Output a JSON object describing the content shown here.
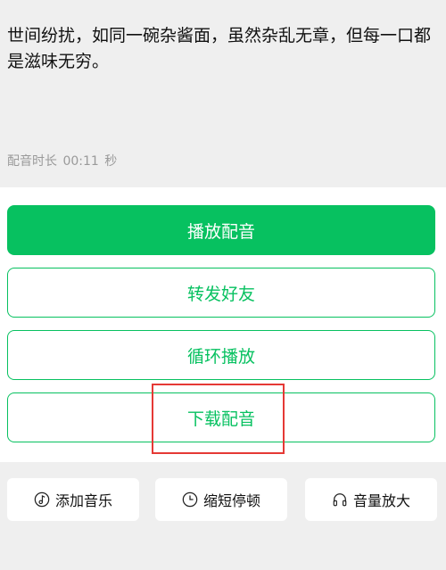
{
  "content": {
    "text": "世间纷扰，如同一碗杂酱面，虽然杂乱无章，但每一口都是滋味无穷。",
    "duration_label": "配音时长",
    "duration_value": "00:11",
    "duration_unit": "秒"
  },
  "actions": {
    "play": "播放配音",
    "share": "转发好友",
    "loop": "循环播放",
    "download": "下载配音"
  },
  "tools": [
    {
      "label": "添加音乐",
      "icon": "music-note-icon"
    },
    {
      "label": "缩短停顿",
      "icon": "clock-icon"
    },
    {
      "label": "音量放大",
      "icon": "headphones-icon"
    }
  ],
  "colors": {
    "accent": "#07c160",
    "highlight": "#e53935",
    "background": "#efefef"
  }
}
